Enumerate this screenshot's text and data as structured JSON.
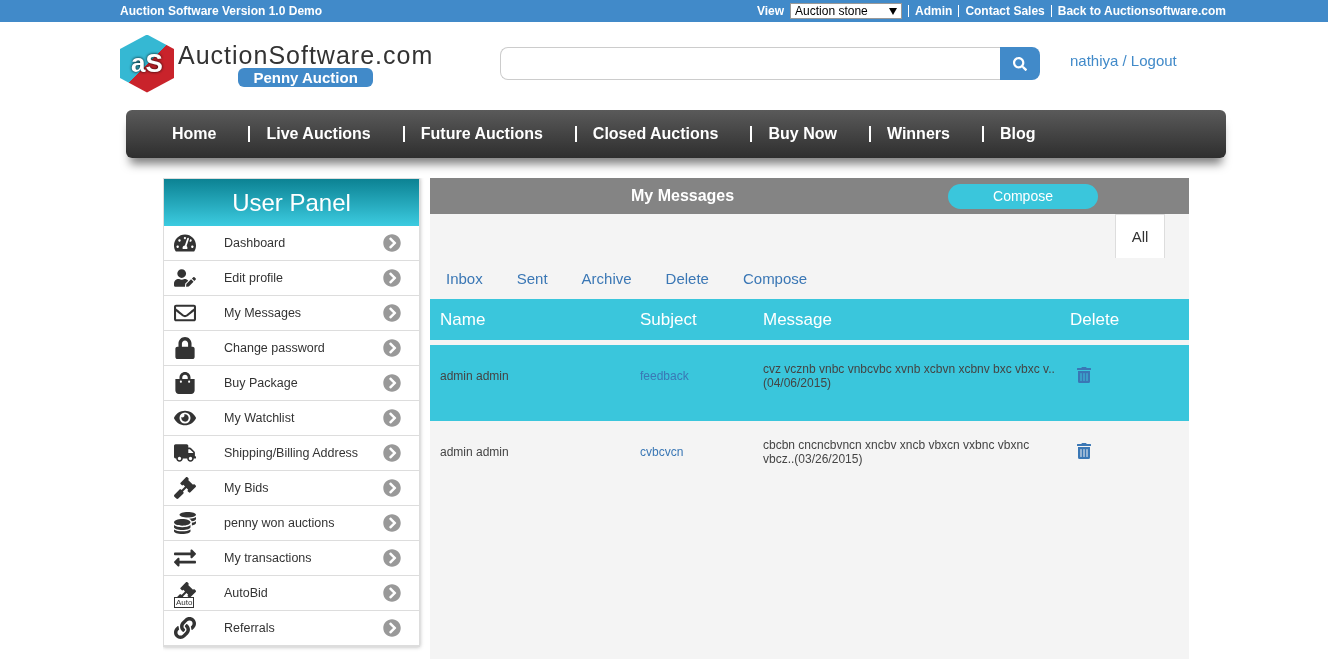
{
  "top_bar": {
    "title": "Auction Software Version 1.0 Demo",
    "view_label": "View",
    "view_value": "Auction stone",
    "links": [
      "Admin",
      "Contact Sales",
      "Back to Auctionsoftware.com"
    ]
  },
  "header": {
    "logo_mark": "aS",
    "logo_text": "AuctionSoftware.com",
    "logo_badge": "Penny Auction",
    "user_link": "nathiya / Logout"
  },
  "nav": [
    "Home",
    "Live Auctions",
    "Future Auctions",
    "Closed Auctions",
    "Buy Now",
    "Winners",
    "Blog"
  ],
  "sidebar": {
    "title": "User Panel",
    "items": [
      {
        "label": "Dashboard"
      },
      {
        "label": "Edit profile"
      },
      {
        "label": "My Messages"
      },
      {
        "label": "Change password"
      },
      {
        "label": "Buy Package"
      },
      {
        "label": "My Watchlist"
      },
      {
        "label": "Shipping/Billing Address"
      },
      {
        "label": "My Bids"
      },
      {
        "label": "penny won auctions"
      },
      {
        "label": "My transactions"
      },
      {
        "label": "AutoBid",
        "badge": "Auto"
      },
      {
        "label": "Referrals"
      }
    ]
  },
  "messages": {
    "title": "My Messages",
    "compose_button": "Compose",
    "filter_tab": "All",
    "tabs": [
      "Inbox",
      "Sent",
      "Archive",
      "Delete",
      "Compose"
    ],
    "columns": [
      "Name",
      "Subject",
      "Message",
      "Delete"
    ],
    "rows": [
      {
        "name": "admin admin",
        "subject": "feedback",
        "message": "cvz vcznb vnbc vnbcvbc xvnb xcbvn xcbnv bxc vbxc v..(04/06/2015)",
        "selected": true
      },
      {
        "name": "admin admin",
        "subject": "cvbcvcn",
        "message": "cbcbn cncncbvncn xncbv xncb vbxcn vxbnc vbxnc vbcz..(03/26/2015)",
        "selected": false
      }
    ]
  }
}
